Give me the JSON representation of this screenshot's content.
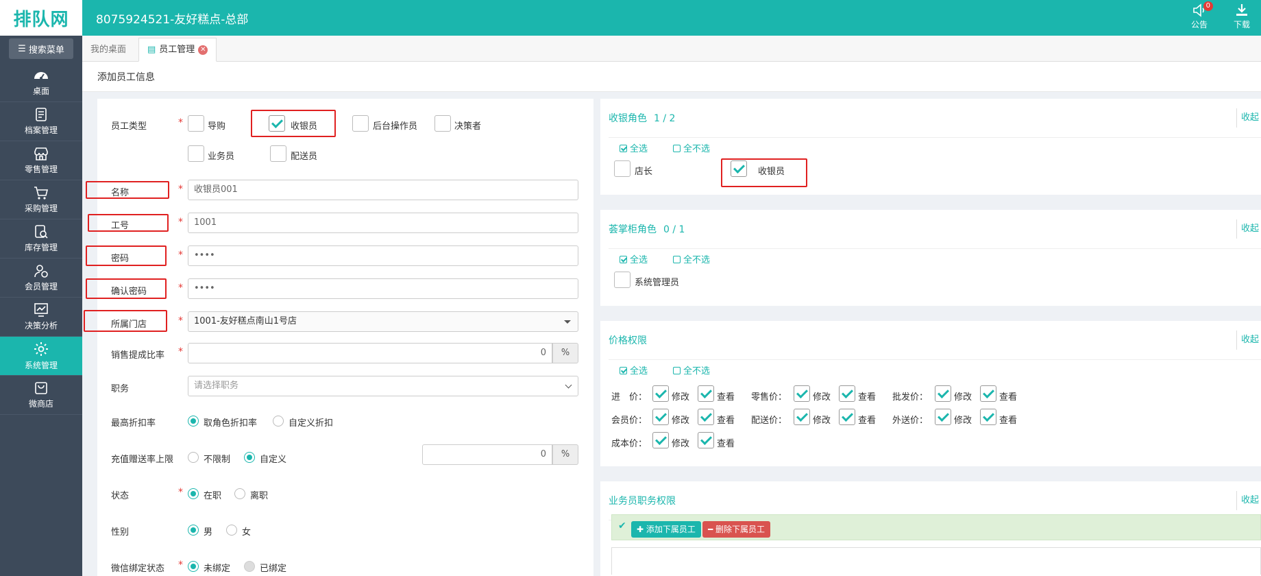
{
  "header": {
    "logo_text": "排队网",
    "store_title": "8075924521-友好糕点-总部",
    "notice_label": "公告",
    "notice_badge": "0",
    "download_label": "下载"
  },
  "sidebar": {
    "search_label": "搜索菜单",
    "items": [
      {
        "label": "桌面",
        "icon": "dashboard-icon"
      },
      {
        "label": "档案管理",
        "icon": "archive-icon"
      },
      {
        "label": "零售管理",
        "icon": "store-icon"
      },
      {
        "label": "采购管理",
        "icon": "cart-icon"
      },
      {
        "label": "库存管理",
        "icon": "inventory-icon"
      },
      {
        "label": "会员管理",
        "icon": "member-icon"
      },
      {
        "label": "决策分析",
        "icon": "chart-icon"
      },
      {
        "label": "系统管理",
        "icon": "gear-icon"
      },
      {
        "label": "微商店",
        "icon": "shop-bag-icon"
      }
    ]
  },
  "tabs": {
    "home": "我的桌面",
    "employee": "员工管理"
  },
  "page_title": "添加员工信息",
  "form": {
    "emp_type_label": "员工类型",
    "emp_types": [
      "导购",
      "收银员",
      "后台操作员",
      "决策者",
      "业务员",
      "配送员"
    ],
    "name_label": "名称",
    "name_value": "收银员001",
    "code_label": "工号",
    "code_value": "1001",
    "pwd_label": "密码",
    "pwd_value": "••••",
    "confirm_label": "确认密码",
    "confirm_value": "••••",
    "store_label": "所属门店",
    "store_value": "1001-友好糕点南山1号店",
    "commission_label": "销售提成比率",
    "commission_value": "0",
    "percent": "%",
    "position_label": "职务",
    "position_placeholder": "请选择职务",
    "discount_label": "最高折扣率",
    "discount_opt1": "取角色折扣率",
    "discount_opt2": "自定义折扣",
    "recharge_label": "充值赠送率上限",
    "recharge_opt1": "不限制",
    "recharge_opt2": "自定义",
    "recharge_value": "0",
    "status_label": "状态",
    "status_opt1": "在职",
    "status_opt2": "离职",
    "gender_label": "性别",
    "gender_opt1": "男",
    "gender_opt2": "女",
    "wechat_label": "微信绑定状态",
    "wechat_opt1": "未绑定",
    "wechat_opt2": "已绑定"
  },
  "right": {
    "collapse": "收起",
    "select_all": "全选",
    "select_none": "全不选",
    "cashier_role": {
      "title": "收银角色",
      "count": "1 / 2",
      "items": [
        "店长",
        "收银员"
      ]
    },
    "palm_role": {
      "title": "荟掌柜角色",
      "count": "0 / 1",
      "items": [
        "系统管理员"
      ]
    },
    "price": {
      "title": "价格权限",
      "modify": "修改",
      "view": "查看",
      "rows": [
        [
          "进　价：",
          "零售价：",
          "批发价："
        ],
        [
          "会员价：",
          "配送价：",
          "外送价："
        ],
        [
          "成本价："
        ]
      ]
    },
    "sales": {
      "title": "业务员职务权限",
      "add_btn": "添加下属员工",
      "del_btn": "删除下属员工"
    }
  }
}
